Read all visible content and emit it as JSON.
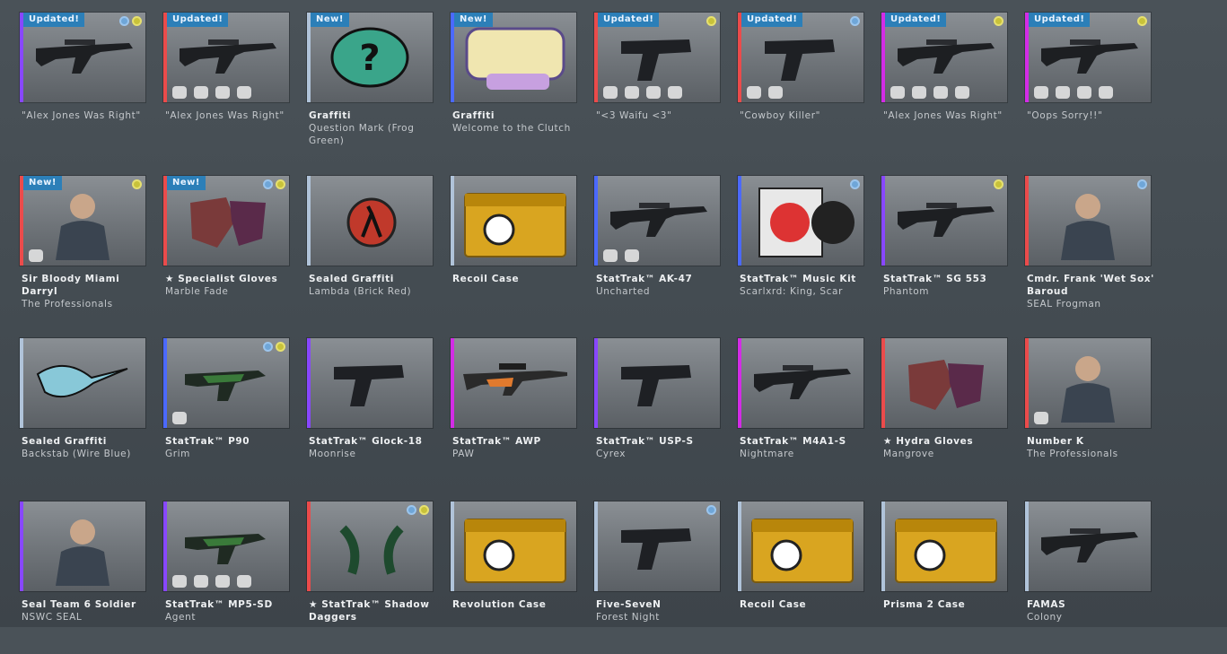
{
  "rarity_colors": {
    "purple": "#8847ff",
    "red": "#eb4b4b",
    "blue": "#4b69ff",
    "lightblue": "#b0c3d9",
    "pink": "#d32ce6",
    "gold": "#e4ae39"
  },
  "items": [
    {
      "badge": "Updated!",
      "name": "",
      "sub": "\"Alex Jones Was Right\""
    },
    {
      "badge": "Updated!",
      "name": "",
      "sub": "\"Alex Jones Was Right\""
    },
    {
      "badge": "New!",
      "name": "Graffiti",
      "sub": "Question Mark (Frog Green)"
    },
    {
      "badge": "New!",
      "name": "Graffiti",
      "sub": "Welcome to the Clutch"
    },
    {
      "badge": "Updated!",
      "name": "",
      "sub": "\"<3 Waifu <3\""
    },
    {
      "badge": "Updated!",
      "name": "",
      "sub": "\"Cowboy Killer\""
    },
    {
      "badge": "Updated!",
      "name": "",
      "sub": "\"Alex Jones Was Right\""
    },
    {
      "badge": "Updated!",
      "name": "",
      "sub": "\"Oops Sorry!!\""
    },
    {
      "badge": "New!",
      "name": "Sir Bloody Miami Darryl",
      "sub": "The Professionals"
    },
    {
      "badge": "New!",
      "name": "★ Specialist Gloves",
      "sub": "Marble Fade"
    },
    {
      "badge": "",
      "name": "Sealed Graffiti",
      "sub": "Lambda (Brick Red)"
    },
    {
      "badge": "",
      "name": "Recoil Case",
      "sub": ""
    },
    {
      "badge": "",
      "name": "StatTrak™ AK-47",
      "sub": "Uncharted"
    },
    {
      "badge": "",
      "name": "StatTrak™ Music Kit",
      "sub": "Scarlxrd: King, Scar"
    },
    {
      "badge": "",
      "name": "StatTrak™ SG 553",
      "sub": "Phantom"
    },
    {
      "badge": "",
      "name": "Cmdr. Frank 'Wet Sox' Baroud",
      "sub": "SEAL Frogman"
    },
    {
      "badge": "",
      "name": "Sealed Graffiti",
      "sub": "Backstab (Wire Blue)"
    },
    {
      "badge": "",
      "name": "StatTrak™ P90",
      "sub": "Grim"
    },
    {
      "badge": "",
      "name": "StatTrak™ Glock-18",
      "sub": "Moonrise"
    },
    {
      "badge": "",
      "name": "StatTrak™ AWP",
      "sub": "PAW"
    },
    {
      "badge": "",
      "name": "StatTrak™ USP-S",
      "sub": "Cyrex"
    },
    {
      "badge": "",
      "name": "StatTrak™ M4A1-S",
      "sub": "Nightmare"
    },
    {
      "badge": "",
      "name": "★ Hydra Gloves",
      "sub": "Mangrove"
    },
    {
      "badge": "",
      "name": "Number K",
      "sub": "The Professionals"
    },
    {
      "badge": "",
      "name": "Seal Team 6 Soldier",
      "sub": "NSWC SEAL"
    },
    {
      "badge": "",
      "name": "StatTrak™ MP5-SD",
      "sub": "Agent"
    },
    {
      "badge": "",
      "name": "★ StatTrak™ Shadow Daggers",
      "sub": ""
    },
    {
      "badge": "",
      "name": "Revolution Case",
      "sub": ""
    },
    {
      "badge": "",
      "name": "Five-SeveN",
      "sub": "Forest Night"
    },
    {
      "badge": "",
      "name": "Recoil Case",
      "sub": ""
    },
    {
      "badge": "",
      "name": "Prisma 2 Case",
      "sub": ""
    },
    {
      "badge": "",
      "name": "FAMAS",
      "sub": "Colony"
    }
  ]
}
